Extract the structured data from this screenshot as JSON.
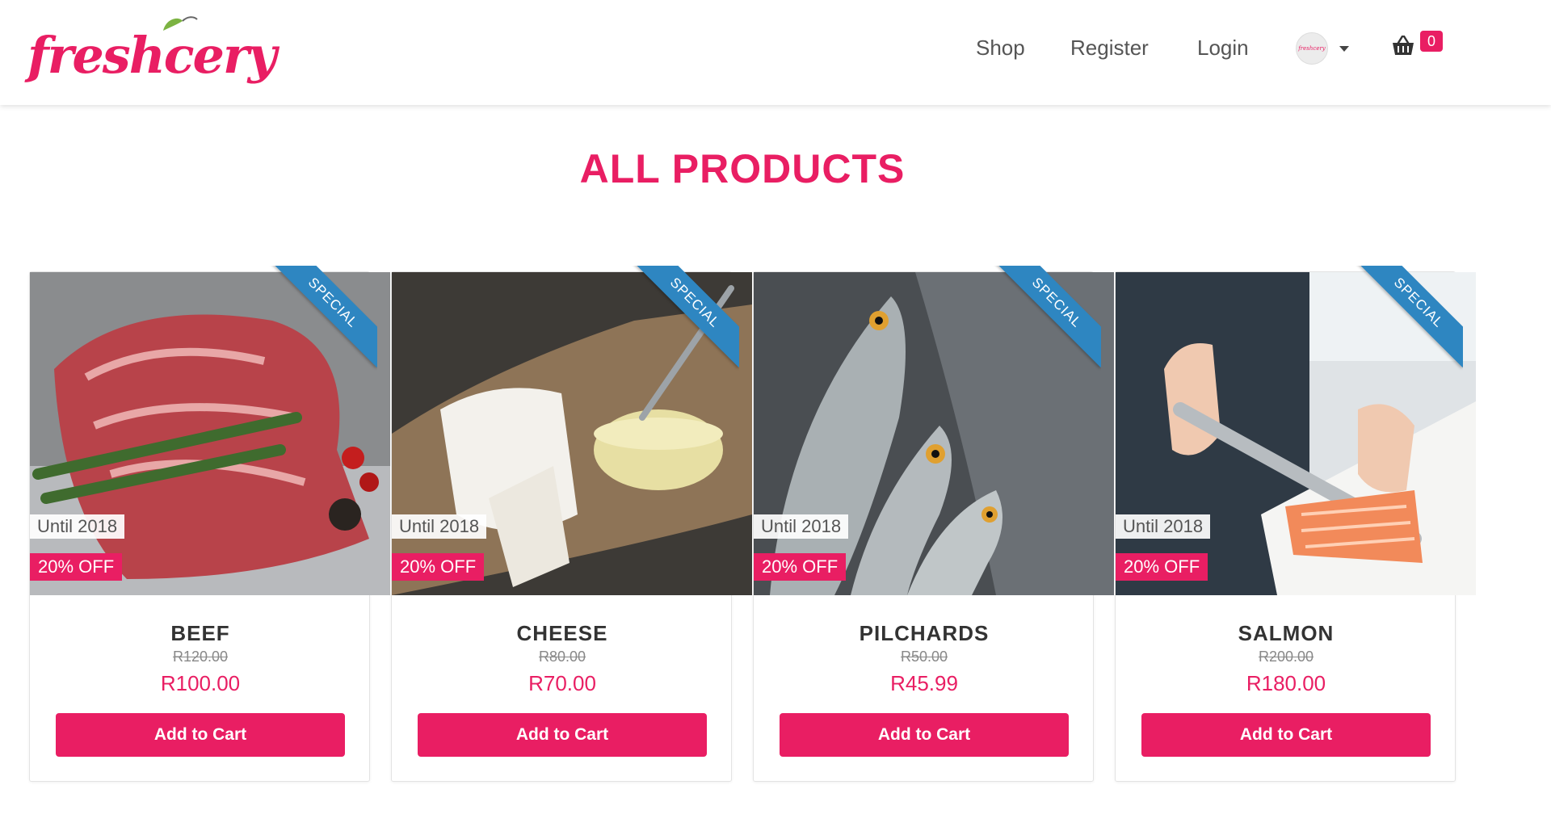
{
  "brand": {
    "logo_text": "freshcery",
    "accent_color": "#e91e63",
    "ribbon_color": "#2e86c1"
  },
  "nav": {
    "shop": "Shop",
    "register": "Register",
    "login": "Login",
    "avatar_text": "freshcery",
    "cart_count": "0",
    "cart_icon": "basket-icon"
  },
  "page_title": "ALL PRODUCTS",
  "products": [
    {
      "name": "BEEF",
      "old_price": "R120.00",
      "price": "R100.00",
      "ribbon": "SPECIAL",
      "until": "Until 2018",
      "discount": "20% OFF",
      "button": "Add to Cart",
      "image": "beef-photo"
    },
    {
      "name": "CHEESE",
      "old_price": "R80.00",
      "price": "R70.00",
      "ribbon": "SPECIAL",
      "until": "Until 2018",
      "discount": "20% OFF",
      "button": "Add to Cart",
      "image": "cheese-photo"
    },
    {
      "name": "PILCHARDS",
      "old_price": "R50.00",
      "price": "R45.99",
      "ribbon": "SPECIAL",
      "until": "Until 2018",
      "discount": "20% OFF",
      "button": "Add to Cart",
      "image": "fish-photo"
    },
    {
      "name": "SALMON",
      "old_price": "R200.00",
      "price": "R180.00",
      "ribbon": "SPECIAL",
      "until": "Until 2018",
      "discount": "20% OFF",
      "button": "Add to Cart",
      "image": "salmon-photo"
    }
  ]
}
